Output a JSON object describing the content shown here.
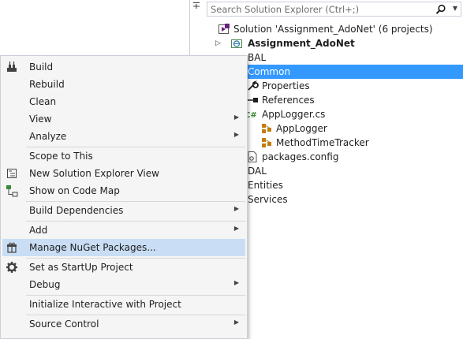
{
  "solution_explorer": {
    "search_placeholder": "Search Solution Explorer (Ctrl+;)",
    "tree": [
      {
        "label": "Solution 'Assignment_AdoNet' (6 projects)",
        "icon": "solution-icon"
      },
      {
        "label": "Assignment_AdoNet",
        "icon": "web-project-icon",
        "bold": true
      },
      {
        "label": "BAL",
        "icon": "project-icon"
      },
      {
        "label": "Common",
        "icon": "project-icon",
        "selected": true
      },
      {
        "label": "Properties",
        "icon": "wrench-icon"
      },
      {
        "label": "References",
        "icon": "references-icon"
      },
      {
        "label": "AppLogger.cs",
        "icon": "csharp-file-icon"
      },
      {
        "label": "AppLogger",
        "icon": "class-icon"
      },
      {
        "label": "MethodTimeTracker",
        "icon": "class-icon"
      },
      {
        "label": "packages.config",
        "icon": "config-file-icon"
      },
      {
        "label": "DAL",
        "icon": "project-icon"
      },
      {
        "label": "Entities",
        "icon": "project-icon"
      },
      {
        "label": "Services",
        "icon": "project-icon"
      }
    ]
  },
  "context_menu": {
    "items": [
      {
        "label": "Build",
        "icon": "build-icon"
      },
      {
        "label": "Rebuild"
      },
      {
        "label": "Clean"
      },
      {
        "label": "View",
        "submenu": true
      },
      {
        "label": "Analyze",
        "submenu": true
      },
      {
        "label": "Scope to This"
      },
      {
        "label": "New Solution Explorer View",
        "icon": "new-view-icon"
      },
      {
        "label": "Show on Code Map",
        "icon": "code-map-icon"
      },
      {
        "label": "Build Dependencies",
        "submenu": true
      },
      {
        "label": "Add",
        "submenu": true
      },
      {
        "label": "Manage NuGet Packages...",
        "icon": "nuget-icon",
        "highlighted": true
      },
      {
        "label": "Set as StartUp Project",
        "icon": "gear-icon"
      },
      {
        "label": "Debug",
        "submenu": true
      },
      {
        "label": "Initialize Interactive with Project"
      },
      {
        "label": "Source Control",
        "submenu": true
      }
    ]
  },
  "colors": {
    "selection": "#3399ff",
    "menu_highlight": "#c9def5",
    "menu_background": "#f5f5f5"
  }
}
